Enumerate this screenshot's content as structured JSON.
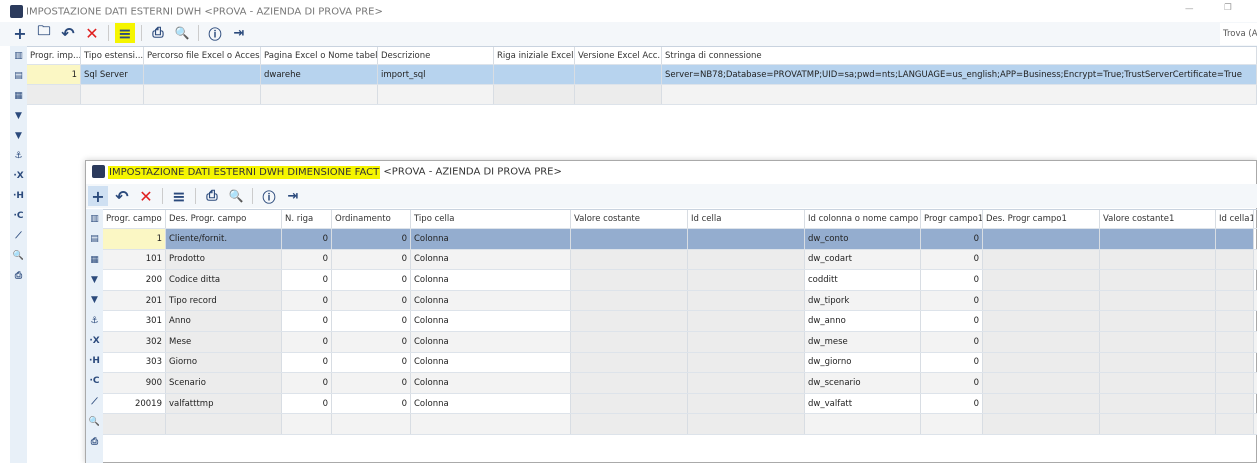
{
  "outer": {
    "title": "IMPOSTAZIONE DATI ESTERNI DWH <PROVA - AZIENDA DI PROVA PRE>",
    "search_label": "Trova (A",
    "columns": [
      "Progr. imp...",
      "Tipo estensi...",
      "Percorso file Excel o Access",
      "Pagina Excel o Nome tabella",
      "Descrizione",
      "Riga iniziale Excel",
      "Versione Excel Acc...",
      "Stringa di connessione"
    ],
    "rows": [
      [
        "1",
        "Sql Server",
        "",
        "dwarehe",
        "import_sql",
        "",
        "",
        "Server=NB78;Database=PROVATMP;UID=sa;pwd=nts;LANGUAGE=us_english;APP=Business;Encrypt=True;TrustServerCertificate=True"
      ]
    ]
  },
  "inner": {
    "title_highlight": "IMPOSTAZIONE DATI ESTERNI DWH DIMENSIONE FACT",
    "title_rest": "<PROVA - AZIENDA DI PROVA PRE>",
    "columns": [
      "Progr. campo",
      "Des. Progr. campo",
      "N. riga",
      "Ordinamento",
      "Tipo cella",
      "Valore costante",
      "Id cella",
      "Id colonna o nome campo",
      "Progr campo1",
      "Des. Progr campo1",
      "Valore costante1",
      "Id cella1"
    ],
    "rows": [
      [
        "1",
        "Cliente/fornit.",
        "0",
        "0",
        "Colonna",
        "",
        "",
        "dw_conto",
        "0",
        "",
        "",
        ""
      ],
      [
        "101",
        "Prodotto",
        "0",
        "0",
        "Colonna",
        "",
        "",
        "dw_codart",
        "0",
        "",
        "",
        ""
      ],
      [
        "200",
        "Codice ditta",
        "0",
        "0",
        "Colonna",
        "",
        "",
        "codditt",
        "0",
        "",
        "",
        ""
      ],
      [
        "201",
        "Tipo record",
        "0",
        "0",
        "Colonna",
        "",
        "",
        "dw_tipork",
        "0",
        "",
        "",
        ""
      ],
      [
        "301",
        "Anno",
        "0",
        "0",
        "Colonna",
        "",
        "",
        "dw_anno",
        "0",
        "",
        "",
        ""
      ],
      [
        "302",
        "Mese",
        "0",
        "0",
        "Colonna",
        "",
        "",
        "dw_mese",
        "0",
        "",
        "",
        ""
      ],
      [
        "303",
        "Giorno",
        "0",
        "0",
        "Colonna",
        "",
        "",
        "dw_giorno",
        "0",
        "",
        "",
        ""
      ],
      [
        "900",
        "Scenario",
        "0",
        "0",
        "Colonna",
        "",
        "",
        "dw_scenario",
        "0",
        "",
        "",
        ""
      ],
      [
        "20019",
        "valfatttmp",
        "0",
        "0",
        "Colonna",
        "",
        "",
        "dw_valfatt",
        "0",
        "",
        "",
        ""
      ]
    ]
  },
  "colors": {
    "highlight": "#f5f500",
    "selected": "#b7d3ee",
    "selected_inner": "#94adcf",
    "accent": "#2b4a7c"
  },
  "side_icons": [
    "layout-icon",
    "record-icon",
    "record-icon",
    "filter-icon",
    "filter-clear-icon",
    "anchor-icon",
    "x-icon",
    "h-icon",
    "c-icon",
    "chart-icon",
    "preview-icon",
    "print-icon"
  ],
  "side_glyphs": [
    "▥",
    "▤",
    "▦",
    "▼",
    "▼",
    "⚓",
    "·X",
    "·H",
    "·C",
    "⟋",
    "🔍",
    "⎙"
  ]
}
